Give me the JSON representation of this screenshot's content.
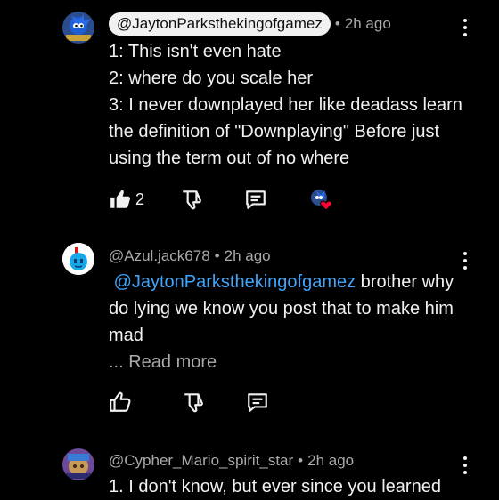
{
  "comments": [
    {
      "author": "@JaytonParksthekingofgamez",
      "time": "2h ago",
      "lines": [
        "1: This isn't even hate",
        "2: where do you scale her",
        "3: I never downplayed her like deadass learn",
        "the definition of \"Downplaying\" Before just",
        "using the term out of no where"
      ],
      "like_count": "2"
    },
    {
      "author": "@Azul.jack678",
      "time": "2h ago",
      "mention": "@JaytonParksthekingofgamez",
      "line1_rest": " brother why",
      "line2": "do lying we know you post that to make him",
      "line3": "mad",
      "read_more": "... Read more"
    },
    {
      "author": "@Cypher_Mario_spirit_star",
      "time": "2h ago",
      "line1": "1. I don't know, but ever since you learned"
    }
  ],
  "separator": "•",
  "colors": {
    "background": "#000000",
    "text": "#f1f1f1",
    "secondary": "#aaaaaa",
    "mention": "#3ea6ff",
    "heart": "#ff0033"
  },
  "icons": [
    "like-icon",
    "dislike-icon",
    "reply-icon",
    "creator-heart-icon",
    "more-vert-icon"
  ]
}
